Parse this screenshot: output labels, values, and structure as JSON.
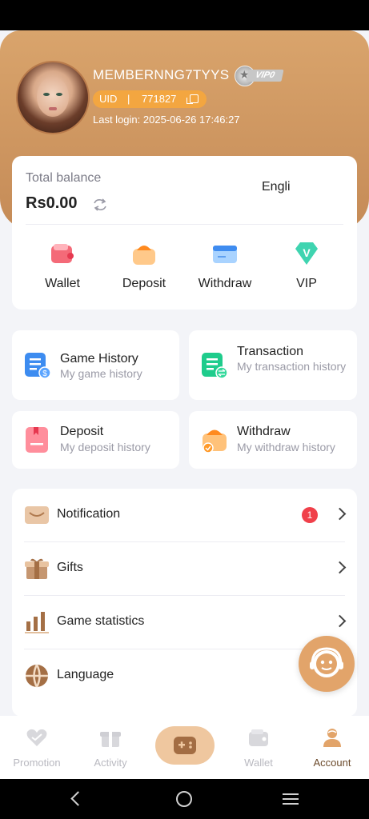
{
  "profile": {
    "username": "MEMBERNNG7TYYS",
    "vip_level": "VIP0",
    "uid_label": "UID",
    "uid_separator": "|",
    "uid_value": "771827",
    "last_login": "Last login: 2025-06-26 17:46:27"
  },
  "balance": {
    "label": "Total balance",
    "value": "Rs0.00"
  },
  "quick_actions": [
    {
      "label": "Wallet",
      "icon": "wallet-icon"
    },
    {
      "label": "Deposit",
      "icon": "deposit-icon"
    },
    {
      "label": "Withdraw",
      "icon": "withdraw-icon"
    },
    {
      "label": "VIP",
      "icon": "vip-icon"
    }
  ],
  "history_cards": [
    {
      "title": "Game History",
      "subtitle": "My game history",
      "icon": "game-history-icon"
    },
    {
      "title": "Transaction",
      "subtitle": "My transaction history",
      "icon": "transaction-icon"
    },
    {
      "title": "Deposit",
      "subtitle": "My deposit history",
      "icon": "deposit-history-icon"
    },
    {
      "title": "Withdraw",
      "subtitle": "My withdraw history",
      "icon": "withdraw-history-icon"
    }
  ],
  "menu": [
    {
      "label": "Notification",
      "badge": "1",
      "icon": "envelope-icon"
    },
    {
      "label": "Gifts",
      "icon": "gift-icon"
    },
    {
      "label": "Game statistics",
      "icon": "bar-chart-icon"
    },
    {
      "label": "Language",
      "value": "Engli",
      "icon": "globe-icon"
    }
  ],
  "tabbar": [
    {
      "label": "Promotion",
      "icon": "promotion-icon"
    },
    {
      "label": "Activity",
      "icon": "activity-icon"
    },
    {
      "label": "",
      "icon": "gamepad-icon"
    },
    {
      "label": "Wallet",
      "icon": "wallet-tab-icon"
    },
    {
      "label": "Account",
      "icon": "account-icon",
      "active": true
    }
  ],
  "colors": {
    "header_gradient_top": "#d9a46c",
    "header_gradient_bottom": "#c58b57",
    "uid_pill": "#f3a640",
    "badge_red": "#f0404a",
    "accent_brown": "#6b4a2b"
  }
}
